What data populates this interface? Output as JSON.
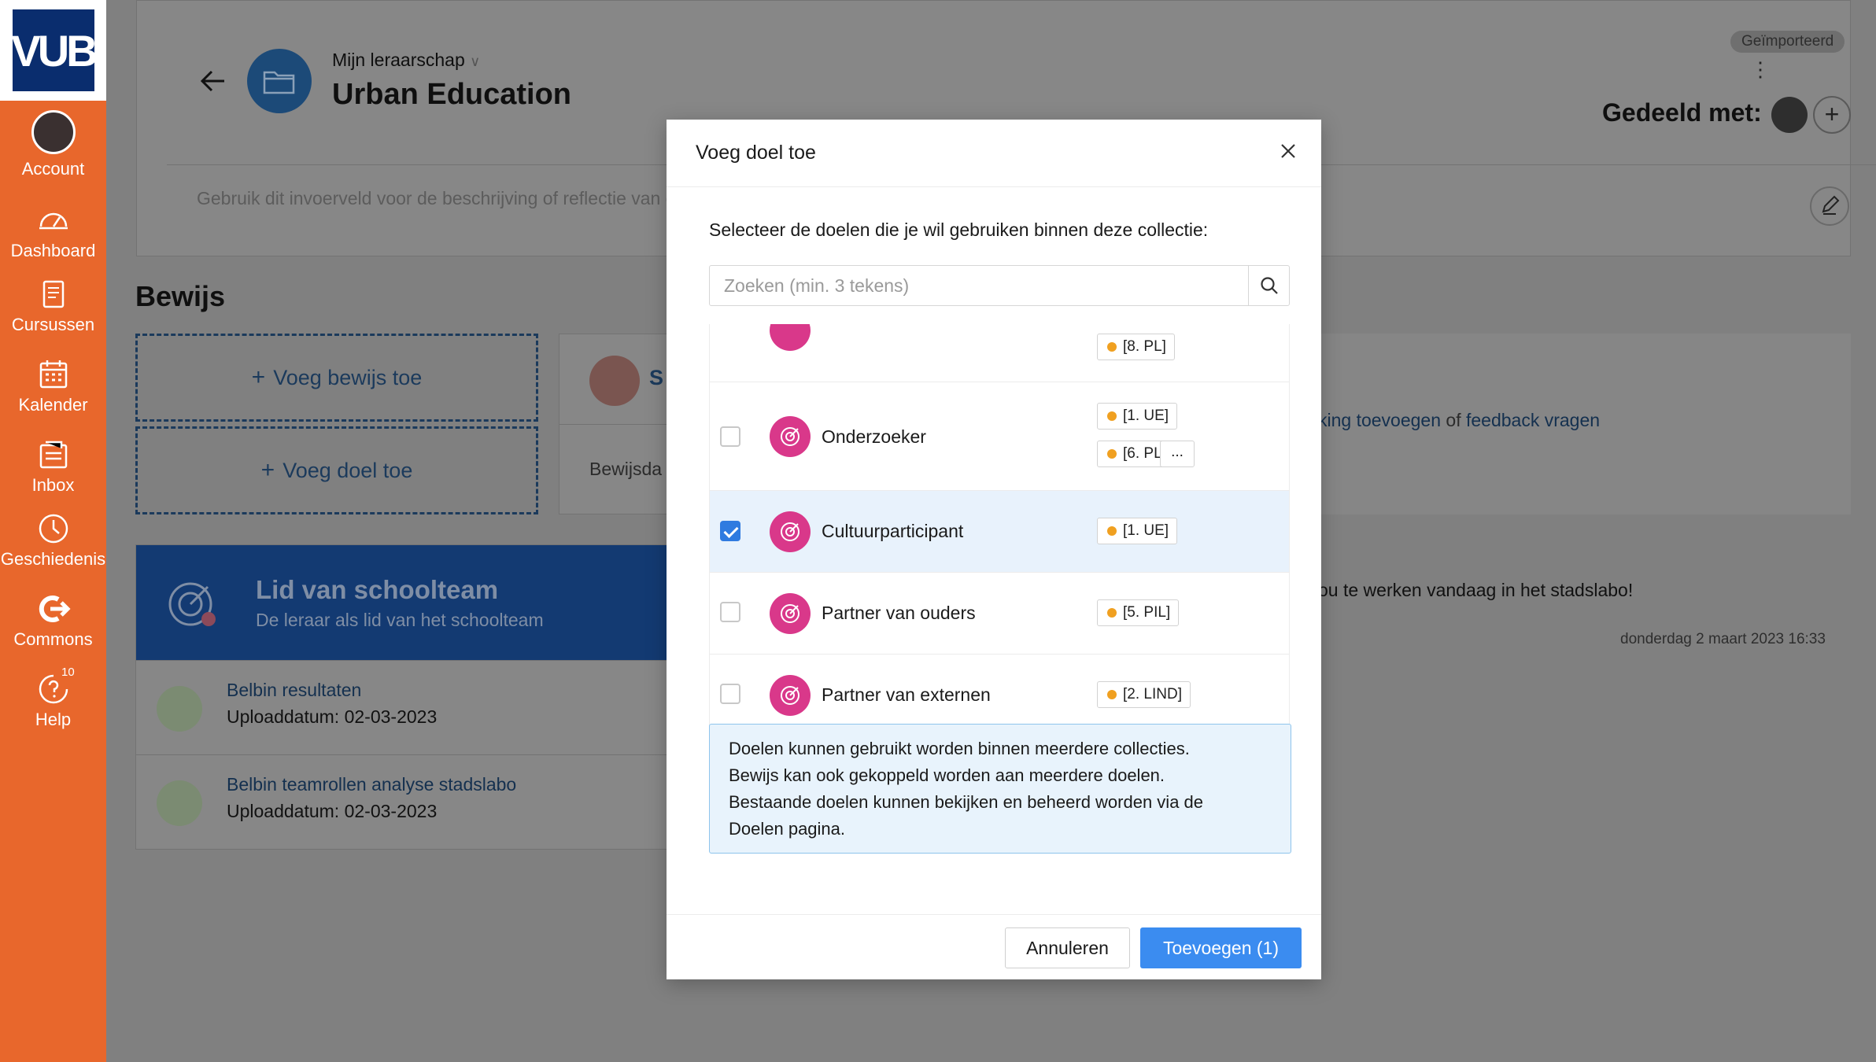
{
  "sidebar": {
    "logo": "VUB",
    "items": [
      {
        "label": "Account",
        "icon": "avatar"
      },
      {
        "label": "Dashboard",
        "icon": "dashboard-icon"
      },
      {
        "label": "Cursussen",
        "icon": "book-icon"
      },
      {
        "label": "Kalender",
        "icon": "calendar-icon"
      },
      {
        "label": "Inbox",
        "icon": "inbox-icon"
      },
      {
        "label": "Geschiedenis",
        "icon": "clock-icon"
      },
      {
        "label": "Commons",
        "icon": "share-icon"
      },
      {
        "label": "Help",
        "icon": "help-icon",
        "badge": "10"
      }
    ]
  },
  "header": {
    "breadcrumb": "Mijn leraarschap",
    "title": "Urban Education",
    "imported_badge": "Geïmporteerd",
    "shared_label": "Gedeeld met:",
    "reflection_placeholder": "Gebruik dit invoerveld voor de beschrijving of reflectie van d"
  },
  "bewijs": {
    "heading": "Bewijs",
    "add_evidence": "Voeg bewijs toe",
    "add_goal": "Voeg doel toe",
    "card_initial": "S",
    "card_text": "Bewijsda"
  },
  "right": {
    "links_prefix": "king toevoegen",
    "links_or": "of",
    "links_feedback": "feedback vragen",
    "message": "ou te werken vandaag in het stadslabo!",
    "date": "donderdag 2 maart 2023 16:33"
  },
  "goal_card": {
    "title": "Lid van schoolteam",
    "subtitle": "De leraar als lid van het schoolteam",
    "files": [
      {
        "title": "Belbin resultaten",
        "date": "Uploaddatum: 02-03-2023"
      },
      {
        "title": "Belbin teamrollen analyse stadslabo",
        "date": "Uploaddatum: 02-03-2023"
      }
    ]
  },
  "modal": {
    "title": "Voeg doel toe",
    "intro": "Selecteer de doelen die je wil gebruiken binnen deze collectie:",
    "search_placeholder": "Zoeken (min. 3 tekens)",
    "goals": [
      {
        "name": "",
        "checked": false,
        "tags": [
          "[8. PL]"
        ]
      },
      {
        "name": "Onderzoeker",
        "checked": false,
        "tags": [
          "[1. UE]",
          "[6. PL]"
        ],
        "more": "..."
      },
      {
        "name": "Cultuurparticipant",
        "checked": true,
        "tags": [
          "[1. UE]"
        ]
      },
      {
        "name": "Partner van ouders",
        "checked": false,
        "tags": [
          "[5. PIL]"
        ]
      },
      {
        "name": "Partner van externen",
        "checked": false,
        "tags": [
          "[2. LIND]"
        ]
      }
    ],
    "info_lines": [
      "Doelen kunnen gebruikt worden binnen meerdere collecties.",
      "Bewijs kan ook gekoppeld worden aan meerdere doelen.",
      "Bestaande doelen kunnen bekijken en beheerd worden via de",
      "Doelen pagina."
    ],
    "cancel_label": "Annuleren",
    "add_label": "Toevoegen (1)"
  },
  "colors": {
    "sidebar": "#e8672c",
    "primary": "#3b8cf0",
    "goal_icon": "#d9388a",
    "tag_dot": "#f0a020"
  }
}
